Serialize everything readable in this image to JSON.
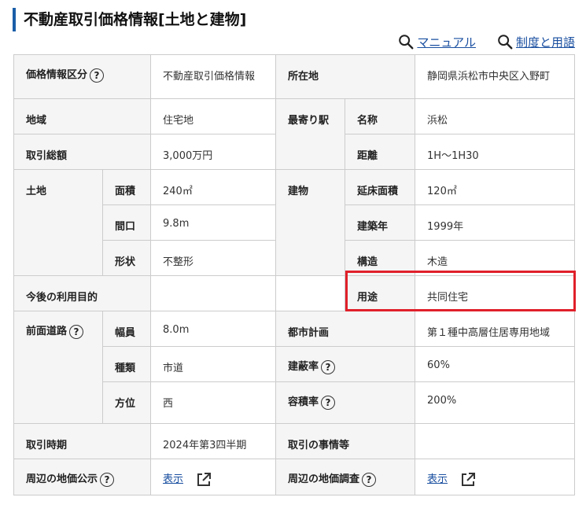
{
  "title": "不動産取引価格情報[土地と建物]",
  "links": {
    "manual": "マニュアル",
    "glossary": "制度と用語"
  },
  "rows": {
    "price_category": {
      "label": "価格情報区分",
      "value": "不動産取引価格情報"
    },
    "location": {
      "label": "所在地",
      "value": "静岡県浜松市中央区入野町"
    },
    "area_type": {
      "label": "地域",
      "value": "住宅地"
    },
    "nearest_station": {
      "label": "最寄り駅",
      "name_label": "名称",
      "name_value": "浜松",
      "distance_label": "距離",
      "distance_value": "1H～1H30"
    },
    "total_price": {
      "label": "取引総額",
      "value": "3,000万円"
    },
    "land": {
      "label": "土地",
      "area_label": "面積",
      "area_value": "240㎡",
      "frontage_label": "間口",
      "frontage_value": "9.8m",
      "shape_label": "形状",
      "shape_value": "不整形"
    },
    "building": {
      "label": "建物",
      "floor_label": "延床面積",
      "floor_value": "120㎡",
      "year_label": "建築年",
      "year_value": "1999年",
      "structure_label": "構造",
      "structure_value": "木造",
      "use_label": "用途",
      "use_value": "共同住宅"
    },
    "future_use": {
      "label": "今後の利用目的",
      "value": ""
    },
    "front_road": {
      "label": "前面道路",
      "width_label": "幅員",
      "width_value": "8.0m",
      "type_label": "種類",
      "type_value": "市道",
      "direction_label": "方位",
      "direction_value": "西"
    },
    "city_plan": {
      "label": "都市計画",
      "value": "第１種中高層住居専用地域"
    },
    "coverage": {
      "label": "建蔽率",
      "value": "60%"
    },
    "far": {
      "label": "容積率",
      "value": "200%"
    },
    "period": {
      "label": "取引時期",
      "value": "2024年第3四半期"
    },
    "circumstances": {
      "label": "取引の事情等",
      "value": ""
    },
    "land_price_public": {
      "label": "周辺の地価公示",
      "link": "表示"
    },
    "land_price_survey": {
      "label": "周辺の地価調査",
      "link": "表示"
    }
  }
}
